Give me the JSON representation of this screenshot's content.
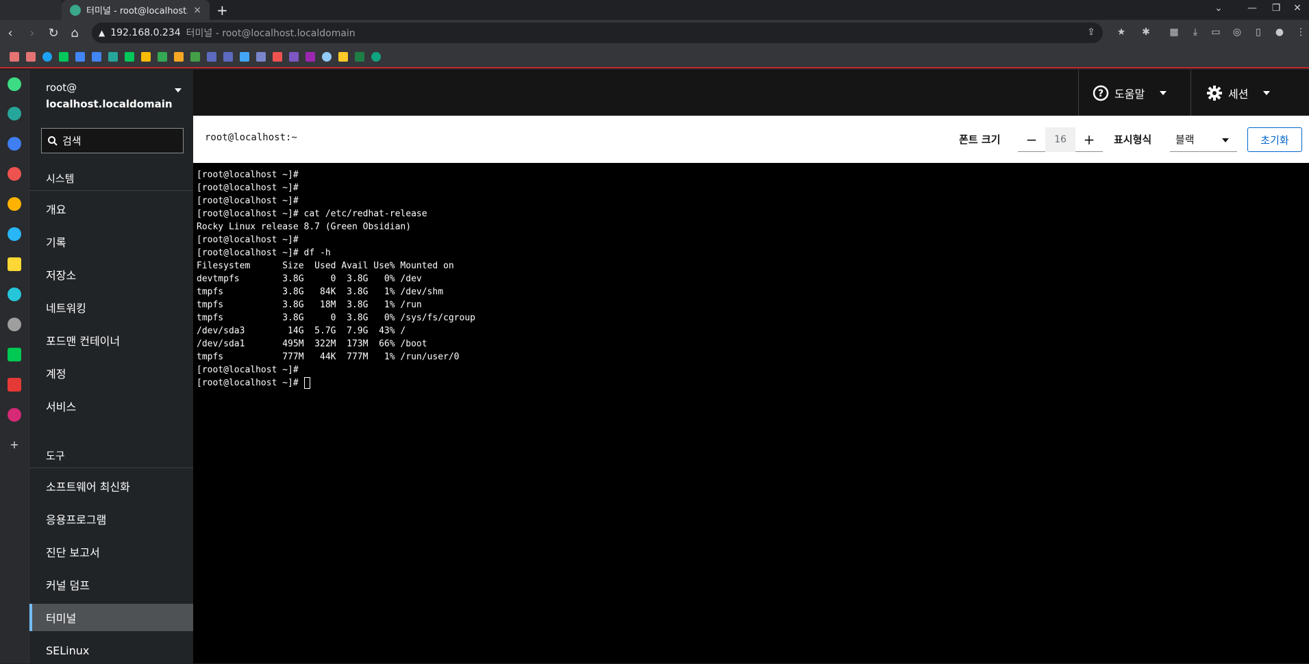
{
  "browser": {
    "tab_title": "터미널 - root@localhost.localdomain",
    "address_host": "192.168.0.234",
    "address_title": "터미널 - root@localhost.localdomain",
    "new_tab": "+",
    "close_tab": "×"
  },
  "sidebar": {
    "host_user": "root@",
    "host_name": "localhost.localdomain",
    "search_placeholder": "검색",
    "section_system": "시스템",
    "system_items": [
      "개요",
      "기록",
      "저장소",
      "네트워킹",
      "포드맨 컨테이너",
      "계정",
      "서비스"
    ],
    "section_tools": "도구",
    "tool_items": [
      "소프트웨어 최신화",
      "응용프로그램",
      "진단 보고서",
      "커널 덤프",
      "터미널",
      "SELinux"
    ],
    "active_item": "터미널"
  },
  "masthead": {
    "help_label": "도움말",
    "session_label": "세션"
  },
  "termbar": {
    "title": "root@localhost:~",
    "font_size_label": "폰트 크기",
    "font_size_value": "16",
    "decrease": "−",
    "increase": "+",
    "appearance_label": "표시형식",
    "appearance_value": "블랙",
    "reset_label": "초기화"
  },
  "terminal": {
    "lines": [
      "[root@localhost ~]#",
      "[root@localhost ~]#",
      "[root@localhost ~]#",
      "[root@localhost ~]# cat /etc/redhat-release",
      "Rocky Linux release 8.7 (Green Obsidian)",
      "[root@localhost ~]#",
      "[root@localhost ~]# df -h",
      "Filesystem      Size  Used Avail Use% Mounted on",
      "devtmpfs        3.8G     0  3.8G   0% /dev",
      "tmpfs           3.8G   84K  3.8G   1% /dev/shm",
      "tmpfs           3.8G   18M  3.8G   1% /run",
      "tmpfs           3.8G     0  3.8G   0% /sys/fs/cgroup",
      "/dev/sda3        14G  5.7G  7.9G  43% /",
      "/dev/sda1       495M  322M  173M  66% /boot",
      "tmpfs           777M   44K  777M   1% /run/user/0",
      "[root@localhost ~]#"
    ],
    "prompt": "[root@localhost ~]# "
  },
  "colors": {
    "accent": "#73bcf7",
    "link": "#0066cc",
    "bookmark_bar_border": "#c62828"
  }
}
